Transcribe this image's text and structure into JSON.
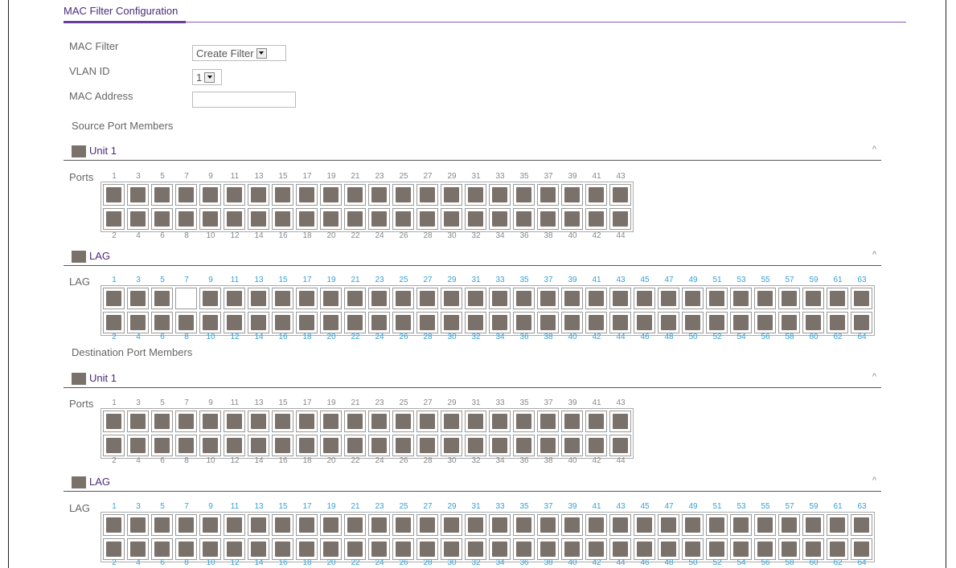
{
  "page_title": "MAC Filter Configuration",
  "form": {
    "mac_filter_label": "MAC Filter",
    "mac_filter_value": "Create Filter",
    "vlan_label": "VLAN ID",
    "vlan_value": "1",
    "mac_address_label": "MAC Address",
    "mac_address_value": ""
  },
  "source": {
    "label": "Source Port Members",
    "unit": {
      "name": "Unit 1",
      "row_label": "Ports",
      "odd": [
        "1",
        "3",
        "5",
        "7",
        "9",
        "11",
        "13",
        "15",
        "17",
        "19",
        "21",
        "23",
        "25",
        "27",
        "29",
        "31",
        "33",
        "35",
        "37",
        "39",
        "41",
        "43"
      ],
      "even": [
        "2",
        "4",
        "6",
        "8",
        "10",
        "12",
        "14",
        "16",
        "18",
        "20",
        "22",
        "24",
        "26",
        "28",
        "30",
        "32",
        "34",
        "36",
        "38",
        "40",
        "42",
        "44"
      ]
    },
    "lag": {
      "name": "LAG",
      "row_label": "LAG",
      "odd": [
        "1",
        "3",
        "5",
        "7",
        "9",
        "11",
        "13",
        "15",
        "17",
        "19",
        "21",
        "23",
        "25",
        "27",
        "29",
        "31",
        "33",
        "35",
        "37",
        "39",
        "41",
        "43",
        "45",
        "47",
        "49",
        "51",
        "53",
        "55",
        "57",
        "59",
        "61",
        "63"
      ],
      "even": [
        "2",
        "4",
        "6",
        "8",
        "10",
        "12",
        "14",
        "16",
        "18",
        "20",
        "22",
        "24",
        "26",
        "28",
        "30",
        "32",
        "34",
        "36",
        "38",
        "40",
        "42",
        "44",
        "46",
        "48",
        "50",
        "52",
        "54",
        "56",
        "58",
        "60",
        "62",
        "64"
      ],
      "empty_ports": [
        "7"
      ]
    }
  },
  "destination": {
    "label": "Destination Port Members",
    "unit": {
      "name": "Unit 1",
      "row_label": "Ports",
      "odd": [
        "1",
        "3",
        "5",
        "7",
        "9",
        "11",
        "13",
        "15",
        "17",
        "19",
        "21",
        "23",
        "25",
        "27",
        "29",
        "31",
        "33",
        "35",
        "37",
        "39",
        "41",
        "43"
      ],
      "even": [
        "2",
        "4",
        "6",
        "8",
        "10",
        "12",
        "14",
        "16",
        "18",
        "20",
        "22",
        "24",
        "26",
        "28",
        "30",
        "32",
        "34",
        "36",
        "38",
        "40",
        "42",
        "44"
      ]
    },
    "lag": {
      "name": "LAG",
      "row_label": "LAG",
      "odd": [
        "1",
        "3",
        "5",
        "7",
        "9",
        "11",
        "13",
        "15",
        "17",
        "19",
        "21",
        "23",
        "25",
        "27",
        "29",
        "31",
        "33",
        "35",
        "37",
        "39",
        "41",
        "43",
        "45",
        "47",
        "49",
        "51",
        "53",
        "55",
        "57",
        "59",
        "61",
        "63"
      ],
      "even": [
        "2",
        "4",
        "6",
        "8",
        "10",
        "12",
        "14",
        "16",
        "18",
        "20",
        "22",
        "24",
        "26",
        "28",
        "30",
        "32",
        "34",
        "36",
        "38",
        "40",
        "42",
        "44",
        "46",
        "48",
        "50",
        "52",
        "54",
        "56",
        "58",
        "60",
        "62",
        "64"
      ],
      "empty_ports": []
    }
  },
  "icons": {
    "collapse": "chevron-up-icon",
    "folder": "folder-icon",
    "dropdown": "chevron-down-icon"
  },
  "colors": {
    "accent": "#6b3d9a",
    "port": "#7a716a",
    "lag_number": "#33a0d8"
  }
}
